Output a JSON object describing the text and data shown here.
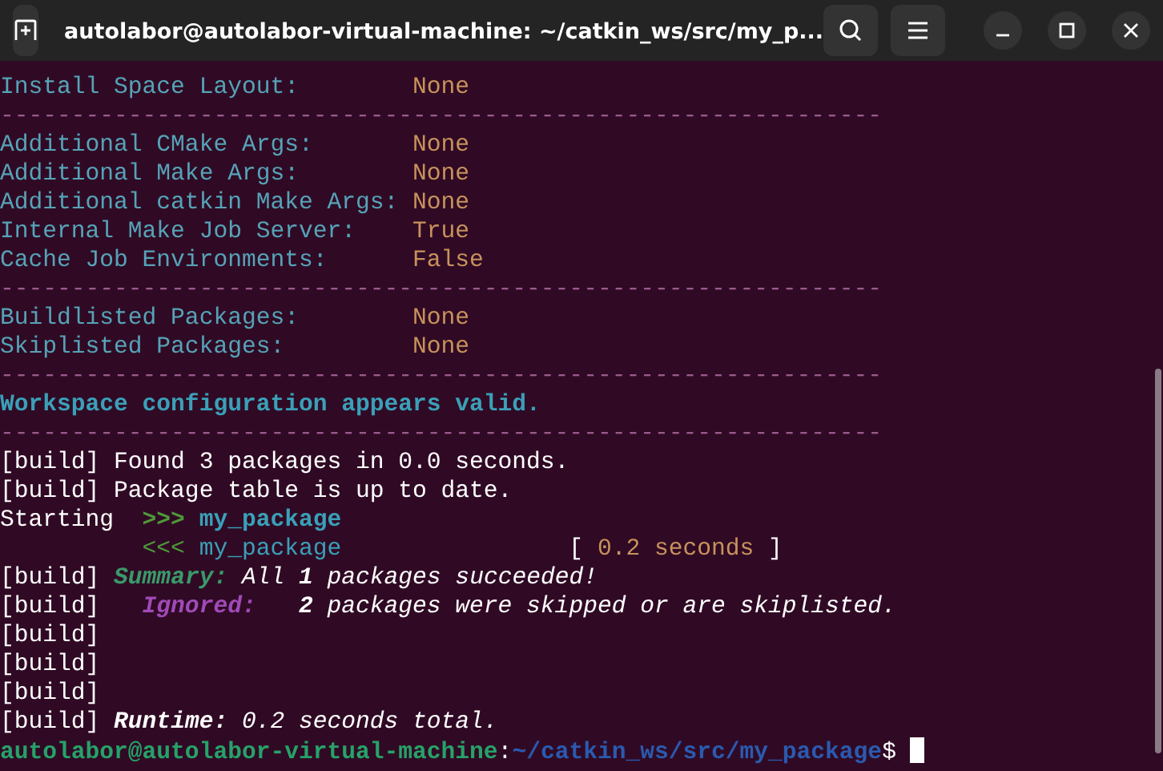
{
  "window": {
    "title": "autolabor@autolabor-virtual-machine: ~/catkin_ws/src/my_p..."
  },
  "terminal": {
    "lines": [
      {
        "segments": [
          {
            "text": "Install Space Layout:",
            "kind": "label"
          },
          {
            "text": "None",
            "kind": "value"
          }
        ]
      },
      {
        "segments": [
          {
            "text": "--------------------------------------------------------------",
            "kind": "rule"
          }
        ]
      },
      {
        "segments": [
          {
            "text": "Additional CMake Args:",
            "kind": "label"
          },
          {
            "text": "None",
            "kind": "value"
          }
        ]
      },
      {
        "segments": [
          {
            "text": "Additional Make Args:",
            "kind": "label"
          },
          {
            "text": "None",
            "kind": "value"
          }
        ]
      },
      {
        "segments": [
          {
            "text": "Additional catkin Make Args:",
            "kind": "label"
          },
          {
            "text": "None",
            "kind": "value"
          }
        ]
      },
      {
        "segments": [
          {
            "text": "Internal Make Job Server:",
            "kind": "label"
          },
          {
            "text": "True",
            "kind": "value"
          }
        ]
      },
      {
        "segments": [
          {
            "text": "Cache Job Environments:",
            "kind": "label"
          },
          {
            "text": "False",
            "kind": "value"
          }
        ]
      },
      {
        "segments": [
          {
            "text": "--------------------------------------------------------------",
            "kind": "rule"
          }
        ]
      },
      {
        "segments": [
          {
            "text": "Buildlisted Packages:",
            "kind": "label"
          },
          {
            "text": "None",
            "kind": "value"
          }
        ]
      },
      {
        "segments": [
          {
            "text": "Skiplisted Packages:",
            "kind": "label"
          },
          {
            "text": "None",
            "kind": "value"
          }
        ]
      },
      {
        "segments": [
          {
            "text": "--------------------------------------------------------------",
            "kind": "rule"
          }
        ]
      },
      {
        "segments": [
          {
            "text": "Workspace configuration appears valid.",
            "kind": "heading"
          }
        ]
      },
      {
        "segments": [
          {
            "text": "--------------------------------------------------------------",
            "kind": "rule"
          }
        ]
      },
      {
        "segments": [
          {
            "text": "[build] Found 3 packages in 0.0 seconds.",
            "kind": "plain"
          }
        ]
      },
      {
        "segments": [
          {
            "text": "[build] Package table is up to date.",
            "kind": "plain"
          }
        ]
      },
      {
        "segments": [
          {
            "text": "Starting  ",
            "kind": "plain"
          },
          {
            "text": ">>> ",
            "kind": "arrowbold"
          },
          {
            "text": "my_package",
            "kind": "pkgbold"
          }
        ]
      },
      {
        "segments": [
          {
            "text": "<<< ",
            "kind": "arrowin"
          },
          {
            "text": "my_package",
            "kind": "pkg"
          },
          {
            "text": "[ ",
            "kind": "bracket"
          },
          {
            "text": "0.2 seconds",
            "kind": "value"
          },
          {
            "text": " ]",
            "kind": "plain"
          }
        ]
      },
      {
        "segments": [
          {
            "text": "[build] ",
            "kind": "plain"
          },
          {
            "text": "Summary:",
            "kind": "summary"
          },
          {
            "text": " All ",
            "kind": "italic"
          },
          {
            "text": "1",
            "kind": "bolditalic"
          },
          {
            "text": " packages succeeded!",
            "kind": "italic"
          }
        ]
      },
      {
        "segments": [
          {
            "text": "[build]   ",
            "kind": "plain"
          },
          {
            "text": "Ignored:",
            "kind": "ignored"
          },
          {
            "text": "2",
            "kind": "bolditalic"
          },
          {
            "text": " packages were skipped or are skiplisted.",
            "kind": "italic"
          }
        ]
      },
      {
        "segments": [
          {
            "text": "[build]",
            "kind": "plain"
          }
        ]
      },
      {
        "segments": [
          {
            "text": "[build]",
            "kind": "plain"
          }
        ]
      },
      {
        "segments": [
          {
            "text": "[build]",
            "kind": "plain"
          }
        ]
      },
      {
        "segments": [
          {
            "text": "[build] ",
            "kind": "plain"
          },
          {
            "text": "Runtime:",
            "kind": "bolditalic"
          },
          {
            "text": " 0.2 seconds total.",
            "kind": "italic"
          }
        ]
      },
      {
        "segments": [
          {
            "text": "autolabor@autolabor-virtual-machine",
            "kind": "user"
          },
          {
            "text": ":",
            "kind": "plain"
          },
          {
            "text": "~/catkin_ws/src/my_package",
            "kind": "path"
          },
          {
            "text": "$ ",
            "kind": "plain"
          }
        ],
        "cursor": true
      }
    ]
  }
}
